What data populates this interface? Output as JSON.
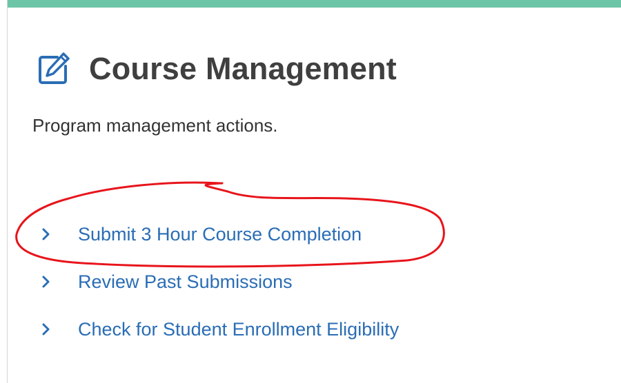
{
  "card": {
    "accent_color": "#6cc5a7",
    "title": "Course Management",
    "title_icon": "edit-icon",
    "subtitle": "Program management actions."
  },
  "links": [
    {
      "label": "Submit 3 Hour Course Completion",
      "icon": "chevron-right-icon"
    },
    {
      "label": "Review Past Submissions",
      "icon": "chevron-right-icon"
    },
    {
      "label": "Check for Student Enrollment Eligibility",
      "icon": "chevron-right-icon"
    }
  ],
  "colors": {
    "link": "#2a6db5",
    "title": "#3f3f3f",
    "icon": "#2a6db5",
    "annotation": "#e8141b"
  }
}
